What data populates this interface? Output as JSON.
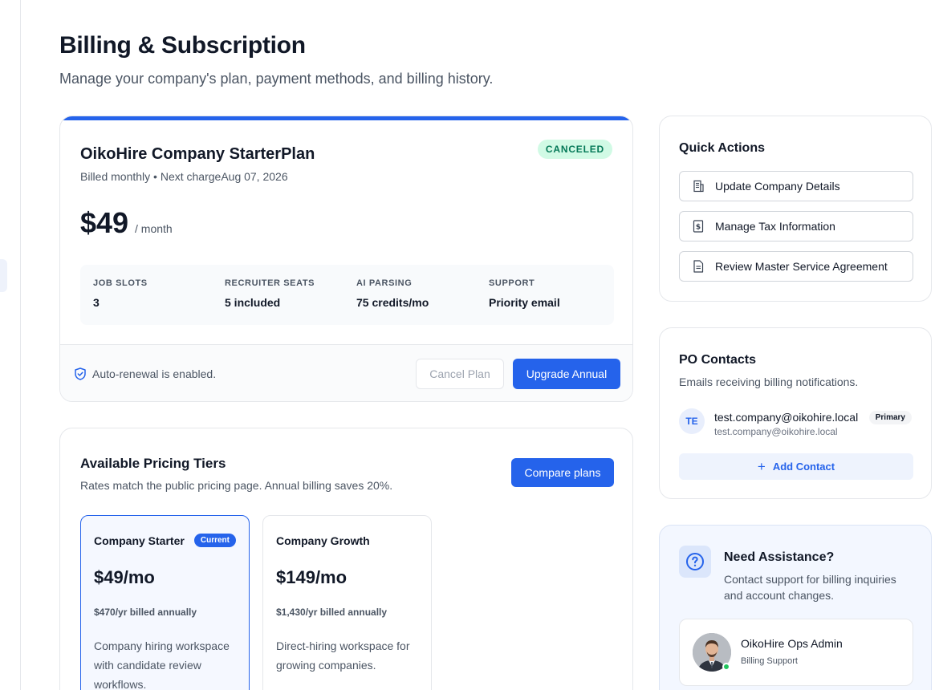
{
  "page": {
    "title": "Billing & Subscription",
    "subtitle": "Manage your company's plan, payment methods, and billing history."
  },
  "plan": {
    "name": "OikoHire Company StarterPlan",
    "meta": "Billed monthly • Next chargeAug 07, 2026",
    "status": "CANCELED",
    "price": "$49",
    "price_unit": "/ month",
    "features": [
      {
        "label": "JOB SLOTS",
        "value": "3"
      },
      {
        "label": "RECRUITER SEATS",
        "value": "5 included"
      },
      {
        "label": "AI PARSING",
        "value": "75 credits/mo"
      },
      {
        "label": "SUPPORT",
        "value": "Priority email"
      }
    ],
    "renewal_text": "Auto-renewal is enabled.",
    "cancel_label": "Cancel Plan",
    "upgrade_label": "Upgrade Annual"
  },
  "tiers": {
    "title": "Available Pricing Tiers",
    "subtitle": "Rates match the public pricing page. Annual billing saves 20%.",
    "compare_label": "Compare plans",
    "items": [
      {
        "name": "Company Starter",
        "badge": "Current",
        "price": "$49/mo",
        "annual": "$470/yr billed annually",
        "description": "Company hiring workspace with candidate review workflows."
      },
      {
        "name": "Company Growth",
        "badge": "",
        "price": "$149/mo",
        "annual": "$1,430/yr billed annually",
        "description": "Direct-hiring workspace for growing companies."
      }
    ]
  },
  "quick_actions": {
    "title": "Quick Actions",
    "items": [
      {
        "label": "Update Company Details",
        "icon": "building-icon"
      },
      {
        "label": "Manage Tax Information",
        "icon": "dollar-document-icon"
      },
      {
        "label": "Review Master Service Agreement",
        "icon": "document-icon"
      }
    ]
  },
  "po_contacts": {
    "title": "PO Contacts",
    "subtitle": "Emails receiving billing notifications.",
    "contacts": [
      {
        "initials": "TE",
        "email": "test.company@oikohire.local",
        "email_sub": "test.company@oikohire.local",
        "badge": "Primary"
      }
    ],
    "add_label": "Add Contact"
  },
  "assistance": {
    "title": "Need Assistance?",
    "text": "Contact support for billing inquiries and account changes.",
    "agent_name": "OikoHire Ops Admin",
    "agent_role": "Billing Support"
  },
  "colors": {
    "accent": "#2563eb",
    "status_canceled_bg": "#d1fae5",
    "status_canceled_text": "#047857",
    "online": "#22c55e"
  }
}
